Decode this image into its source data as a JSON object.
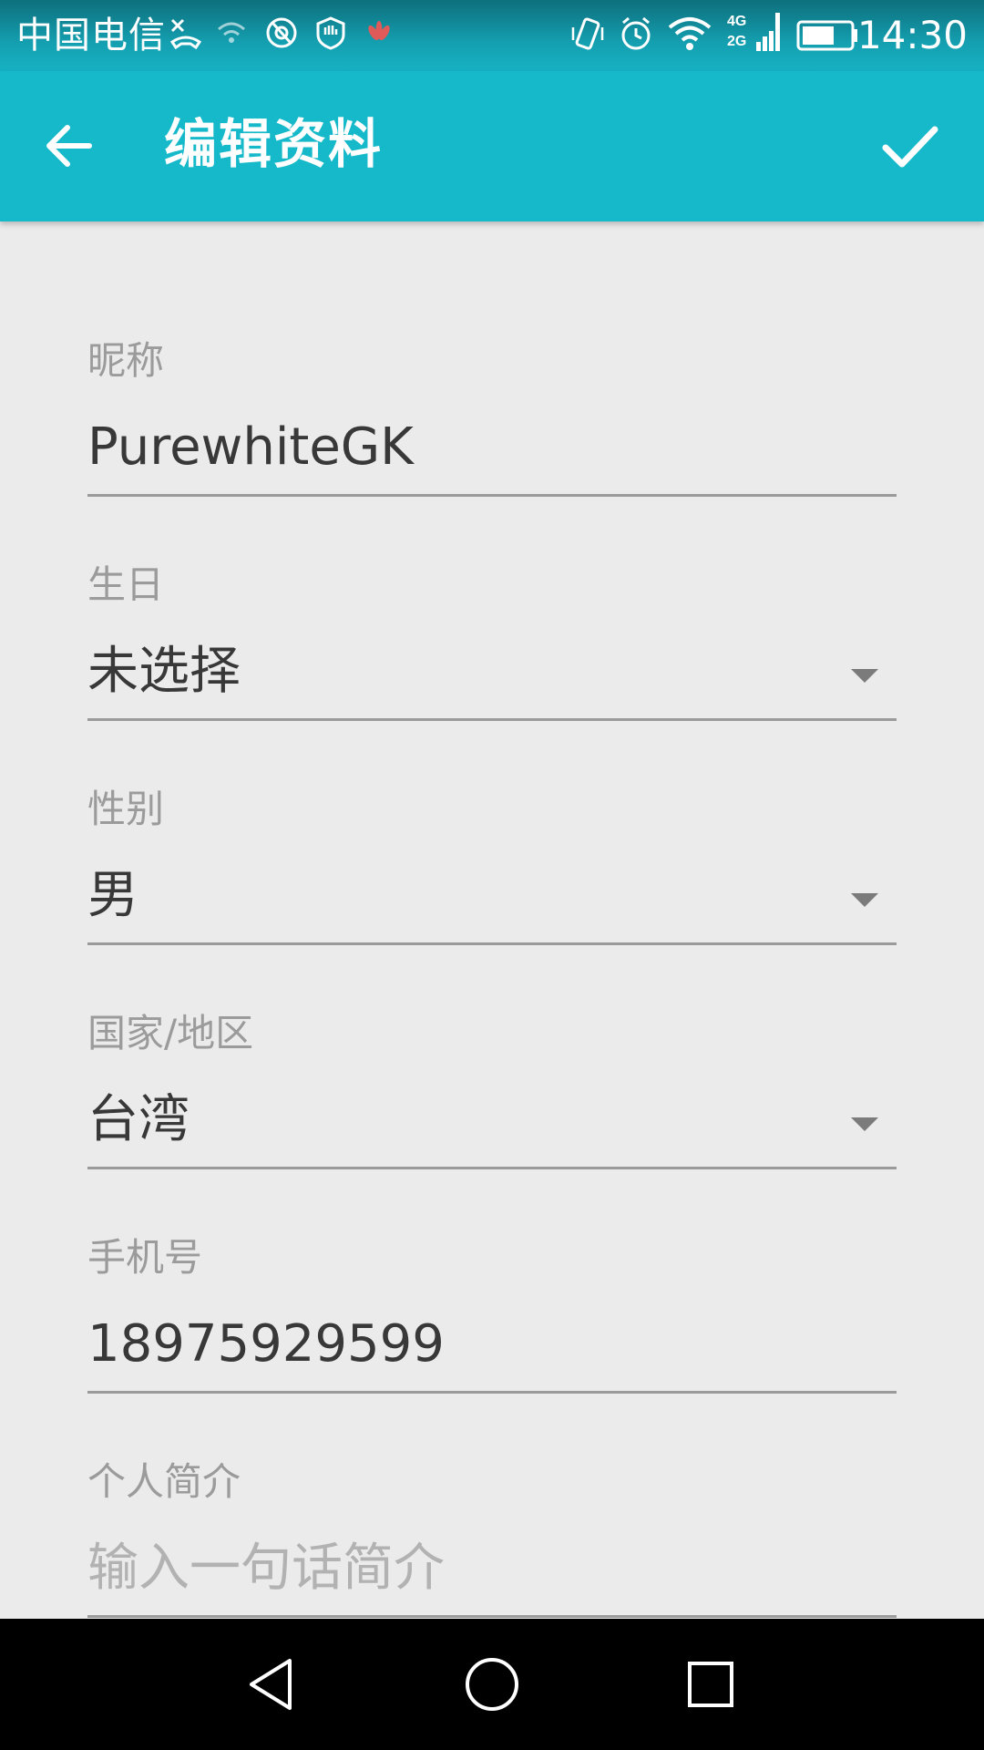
{
  "status_bar": {
    "carrier": "中国电信",
    "time": "14:30",
    "network_tag_top": "4G",
    "network_tag_bottom": "2G",
    "icons": [
      "missed-call-icon",
      "wifi-assist-icon",
      "circle-app-icon",
      "shield-icon",
      "huawei-logo-icon",
      "vibrate-icon",
      "alarm-icon",
      "wifi-icon",
      "signal-icon",
      "battery-icon"
    ]
  },
  "app_bar": {
    "title": "编辑资料",
    "back_icon": "arrow-left-icon",
    "confirm_icon": "check-icon",
    "background_color": "#16b9c9"
  },
  "form": {
    "nickname": {
      "label": "昵称",
      "value": "PurewhiteGK"
    },
    "birthday": {
      "label": "生日",
      "value": "未选择"
    },
    "gender": {
      "label": "性别",
      "value": "男"
    },
    "region": {
      "label": "国家/地区",
      "value": "台湾"
    },
    "phone": {
      "label": "手机号",
      "value": "18975929599"
    },
    "bio": {
      "label": "个人简介",
      "placeholder": "输入一句话简介"
    }
  },
  "nav_bar": {
    "icons": [
      "back-triangle-icon",
      "home-circle-icon",
      "recents-square-icon"
    ]
  }
}
